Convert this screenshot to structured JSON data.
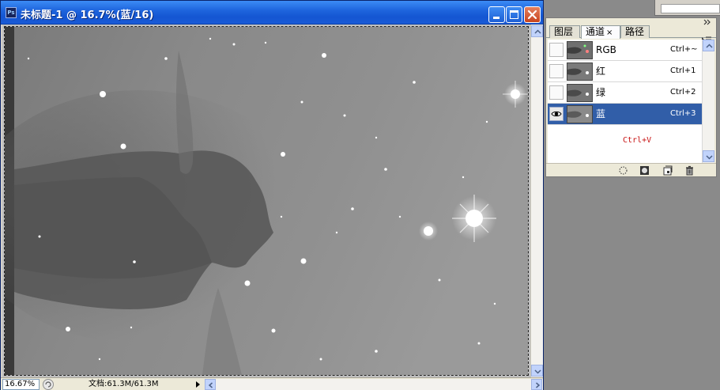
{
  "document": {
    "title": "未标题-1 @ 16.7%(蓝/16)",
    "status": {
      "zoom": "16.67%",
      "doc_info": "文档:61.3M/61.3M"
    }
  },
  "palette": {
    "tabs": [
      {
        "label": "图层"
      },
      {
        "label": "通道",
        "close": "×",
        "active": true
      },
      {
        "label": "路径"
      }
    ],
    "channels": [
      {
        "name": "RGB",
        "shortcut": "Ctrl+~",
        "visible": false,
        "selected": false
      },
      {
        "name": "红",
        "shortcut": "Ctrl+1",
        "visible": false,
        "selected": false
      },
      {
        "name": "绿",
        "shortcut": "Ctrl+2",
        "visible": false,
        "selected": false
      },
      {
        "name": "蓝",
        "shortcut": "Ctrl+3",
        "visible": true,
        "selected": true
      }
    ],
    "annotation": "Ctrl+V",
    "bottom_icons": [
      "load-selection-icon",
      "save-selection-icon",
      "new-channel-icon",
      "delete-channel-icon"
    ]
  },
  "colors": {
    "title_bar": "#1f66de",
    "selected_row": "#315ea8",
    "annotation": "#c81414",
    "close_button": "#c8441f"
  }
}
